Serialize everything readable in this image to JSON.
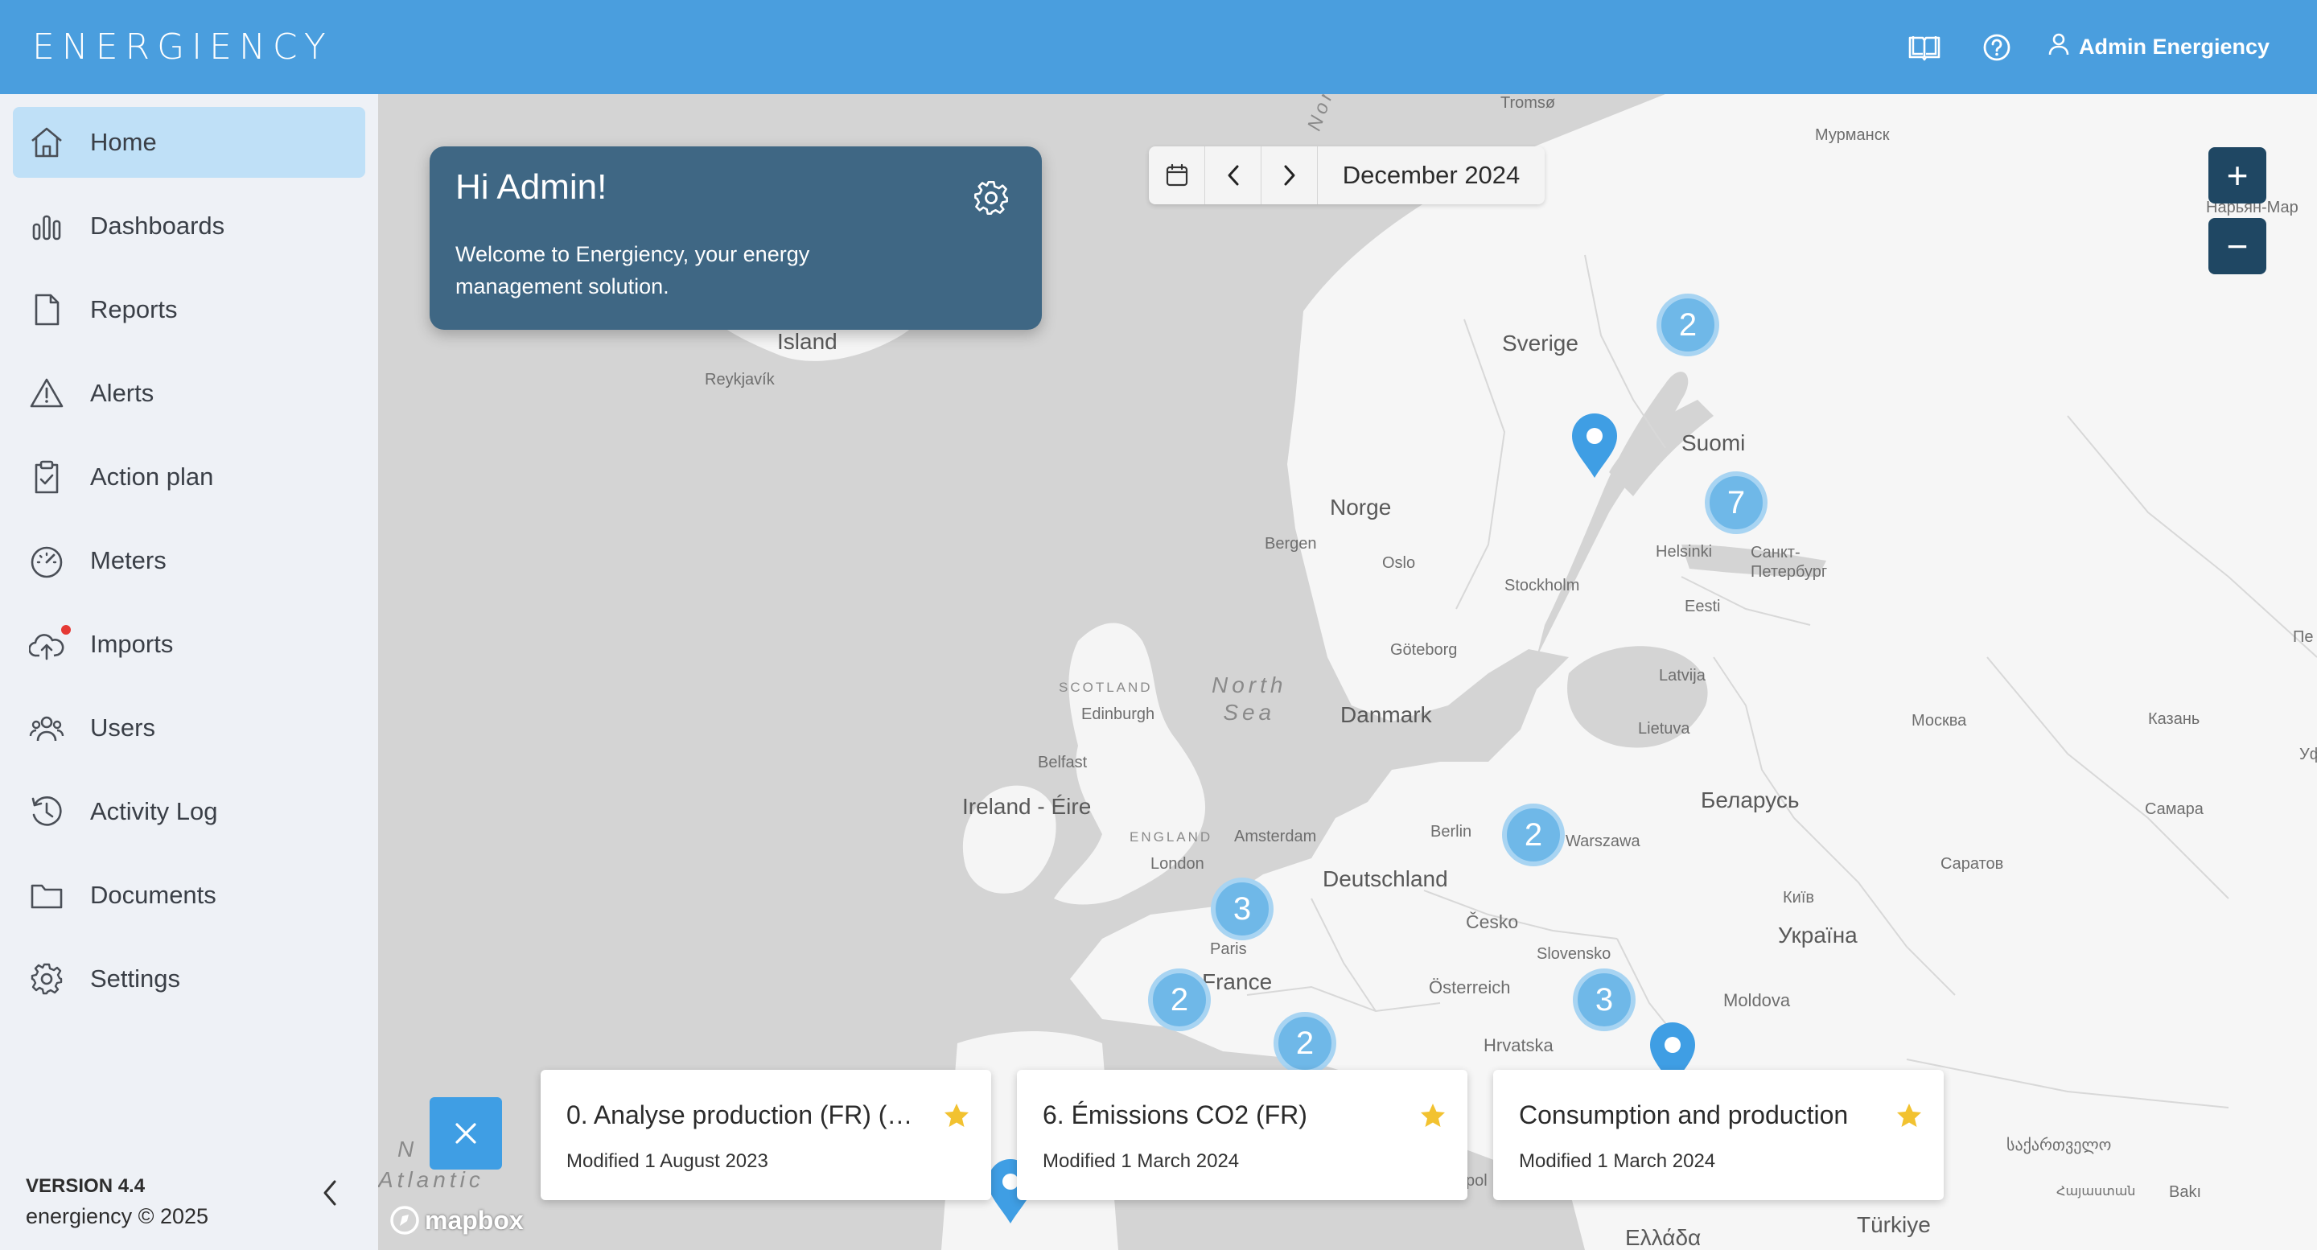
{
  "brand": {
    "logo_text": "ENERGIENCY",
    "accent": "#4a9ede"
  },
  "header": {
    "icons": [
      "book-icon",
      "help-icon",
      "user-icon"
    ],
    "user_name": "Admin Energiency"
  },
  "sidebar": {
    "items": [
      {
        "label": "Home",
        "icon": "home-icon",
        "active": true
      },
      {
        "label": "Dashboards",
        "icon": "bar-chart-icon"
      },
      {
        "label": "Reports",
        "icon": "document-icon"
      },
      {
        "label": "Alerts",
        "icon": "warning-icon"
      },
      {
        "label": "Action plan",
        "icon": "clipboard-check-icon"
      },
      {
        "label": "Meters",
        "icon": "gauge-icon"
      },
      {
        "label": "Imports",
        "icon": "cloud-upload-icon",
        "notification": true
      },
      {
        "label": "Users",
        "icon": "users-icon"
      },
      {
        "label": "Activity Log",
        "icon": "history-icon"
      },
      {
        "label": "Documents",
        "icon": "folder-icon"
      },
      {
        "label": "Settings",
        "icon": "gear-icon"
      }
    ],
    "version": "VERSION 4.4",
    "copyright": "energiency © 2025"
  },
  "welcome": {
    "title": "Hi Admin!",
    "message": "Welcome to Energiency, your energy management solution."
  },
  "datepicker": {
    "value": "December 2024"
  },
  "zoom": {
    "in": "+",
    "out": "−"
  },
  "map": {
    "attribution": "mapbox",
    "labels": {
      "island": "Island",
      "reykjavik": "Reykjavík",
      "murmansk": "Мурманск",
      "naryan": "Нарьян-Мар",
      "sverige": "Sverige",
      "suomi": "Suomi",
      "norge": "Norge",
      "bergen": "Bergen",
      "oslo": "Oslo",
      "helsinki": "Helsinki",
      "spb": "Санкт-\nПетербург",
      "stockholm": "Stockholm",
      "eesti": "Eesti",
      "goteborg": "Göteborg",
      "latvija": "Latvija",
      "scotland": "SCOTLAND",
      "edinburgh": "Edinburgh",
      "north_sea": "North\nSea",
      "danmark": "Danmark",
      "lietuva": "Lietuva",
      "moskva": "Москва",
      "kazan": "Казань",
      "belfast": "Belfast",
      "ireland": "Ireland - Éire",
      "belarus": "Беларусь",
      "samara": "Самара",
      "england": "ENGLAND",
      "amsterdam": "Amsterdam",
      "berlin": "Berlin",
      "warszawa": "Warszawa",
      "london": "London",
      "deutschland": "Deutschland",
      "saratov": "Саратов",
      "kyiv": "Київ",
      "cesko": "Česko",
      "ukraina": "Україна",
      "paris": "Paris",
      "slovensko": "Slovensko",
      "france": "France",
      "osterreich": "Österreich",
      "moldova": "Moldova",
      "hrvatska": "Hrvatska",
      "atlantic": "Atlantic",
      "north_atlantic": "N",
      "georgia": "საქართველო",
      "armenia": "Հայաստան",
      "baki": "Bakı",
      "turkiye": "Türkiye",
      "ellada": "Ελλάδα",
      "pol": "pol",
      "norw": "Norw",
      "tromso": "Tromsø",
      "pe": "Пе",
      "uf": "Уф"
    },
    "clusters": [
      "2",
      "7",
      "2",
      "3",
      "2",
      "2",
      "3"
    ]
  },
  "cards": [
    {
      "title": "0. Analyse production (FR) (c…",
      "meta": "Modified 1 August 2023",
      "favorite": true
    },
    {
      "title": "6. Émissions CO2 (FR)",
      "meta": "Modified 1 March 2024",
      "favorite": true
    },
    {
      "title": "Consumption and production",
      "meta": "Modified 1 March 2024",
      "favorite": true
    }
  ]
}
